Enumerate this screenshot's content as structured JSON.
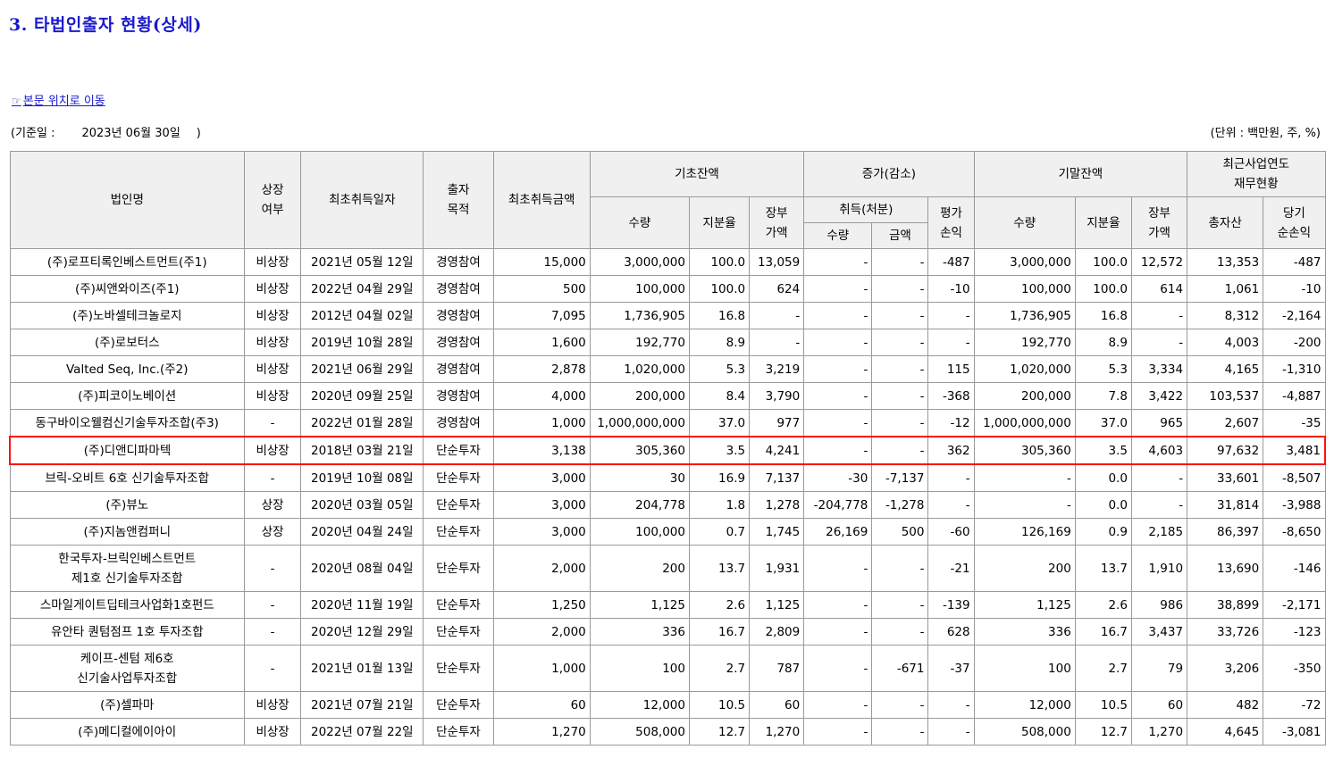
{
  "title": "3. 타법인출자 현황(상세)",
  "nav_link": {
    "icon": "☞",
    "label": "본문 위치로 이동"
  },
  "base_date": {
    "label": "(기준일 :",
    "value": "2023년 06월 30일",
    "close": ")"
  },
  "unit": "(단위 : 백만원, 주, %)",
  "header": {
    "name": "법인명",
    "listed": [
      "상장",
      "여부"
    ],
    "first_date": "최초취득일자",
    "purpose": [
      "출자",
      "목적"
    ],
    "first_amount": "최초취득금액",
    "begin": "기초잔액",
    "change": "증가(감소)",
    "end": "기말잔액",
    "fin": [
      "최근사업연도",
      "재무현황"
    ],
    "qty": "수량",
    "share": "지분율",
    "book": [
      "장부",
      "가액"
    ],
    "acq": "취득(처분)",
    "eval": [
      "평가",
      "손익"
    ],
    "acq_qty": "수량",
    "acq_amt": "금액",
    "total_assets": "총자산",
    "net_income": [
      "당기",
      "순손익"
    ]
  },
  "rows": [
    {
      "name": [
        "(주)로프티록인베스트먼트(주1)"
      ],
      "listed": "비상장",
      "date": "2021년 05월 12일",
      "purpose": "경영참여",
      "amount": "15,000",
      "b_qty": "3,000,000",
      "b_share": "100.0",
      "b_book": "13,059",
      "a_qty": "-",
      "a_amt": "-",
      "eval": "-487",
      "e_qty": "3,000,000",
      "e_share": "100.0",
      "e_book": "12,572",
      "assets": "13,353",
      "income": "-487"
    },
    {
      "name": [
        "(주)씨앤와이즈(주1)"
      ],
      "listed": "비상장",
      "date": "2022년 04월 29일",
      "purpose": "경영참여",
      "amount": "500",
      "b_qty": "100,000",
      "b_share": "100.0",
      "b_book": "624",
      "a_qty": "-",
      "a_amt": "-",
      "eval": "-10",
      "e_qty": "100,000",
      "e_share": "100.0",
      "e_book": "614",
      "assets": "1,061",
      "income": "-10"
    },
    {
      "name": [
        "(주)노바셀테크놀로지"
      ],
      "listed": "비상장",
      "date": "2012년 04월 02일",
      "purpose": "경영참여",
      "amount": "7,095",
      "b_qty": "1,736,905",
      "b_share": "16.8",
      "b_book": "-",
      "a_qty": "-",
      "a_amt": "-",
      "eval": "-",
      "e_qty": "1,736,905",
      "e_share": "16.8",
      "e_book": "-",
      "assets": "8,312",
      "income": "-2,164"
    },
    {
      "name": [
        "(주)로보터스"
      ],
      "listed": "비상장",
      "date": "2019년 10월 28일",
      "purpose": "경영참여",
      "amount": "1,600",
      "b_qty": "192,770",
      "b_share": "8.9",
      "b_book": "-",
      "a_qty": "-",
      "a_amt": "-",
      "eval": "-",
      "e_qty": "192,770",
      "e_share": "8.9",
      "e_book": "-",
      "assets": "4,003",
      "income": "-200"
    },
    {
      "name": [
        "Valted Seq, Inc.(주2)"
      ],
      "listed": "비상장",
      "date": "2021년 06월 29일",
      "purpose": "경영참여",
      "amount": "2,878",
      "b_qty": "1,020,000",
      "b_share": "5.3",
      "b_book": "3,219",
      "a_qty": "-",
      "a_amt": "-",
      "eval": "115",
      "e_qty": "1,020,000",
      "e_share": "5.3",
      "e_book": "3,334",
      "assets": "4,165",
      "income": "-1,310"
    },
    {
      "name": [
        "(주)피코이노베이션"
      ],
      "listed": "비상장",
      "date": "2020년 09월 25일",
      "purpose": "경영참여",
      "amount": "4,000",
      "b_qty": "200,000",
      "b_share": "8.4",
      "b_book": "3,790",
      "a_qty": "-",
      "a_amt": "-",
      "eval": "-368",
      "e_qty": "200,000",
      "e_share": "7.8",
      "e_book": "3,422",
      "assets": "103,537",
      "income": "-4,887"
    },
    {
      "name": [
        "동구바이오웰컴신기술투자조합(주3)"
      ],
      "listed": "-",
      "date": "2022년 01월 28일",
      "purpose": "경영참여",
      "amount": "1,000",
      "b_qty": "1,000,000,000",
      "b_share": "37.0",
      "b_book": "977",
      "a_qty": "-",
      "a_amt": "-",
      "eval": "-12",
      "e_qty": "1,000,000,000",
      "e_share": "37.0",
      "e_book": "965",
      "assets": "2,607",
      "income": "-35"
    },
    {
      "name": [
        "(주)디앤디파마텍"
      ],
      "listed": "비상장",
      "date": "2018년 03월 21일",
      "purpose": "단순투자",
      "amount": "3,138",
      "b_qty": "305,360",
      "b_share": "3.5",
      "b_book": "4,241",
      "a_qty": "-",
      "a_amt": "-",
      "eval": "362",
      "e_qty": "305,360",
      "e_share": "3.5",
      "e_book": "4,603",
      "assets": "97,632",
      "income": "3,481",
      "highlight": true
    },
    {
      "name": [
        "브릭-오비트 6호 신기술투자조합"
      ],
      "listed": "-",
      "date": "2019년 10월 08일",
      "purpose": "단순투자",
      "amount": "3,000",
      "b_qty": "30",
      "b_share": "16.9",
      "b_book": "7,137",
      "a_qty": "-30",
      "a_amt": "-7,137",
      "eval": "-",
      "e_qty": "-",
      "e_share": "0.0",
      "e_book": "-",
      "assets": "33,601",
      "income": "-8,507"
    },
    {
      "name": [
        "(주)뷰노"
      ],
      "listed": "상장",
      "date": "2020년 03월 05일",
      "purpose": "단순투자",
      "amount": "3,000",
      "b_qty": "204,778",
      "b_share": "1.8",
      "b_book": "1,278",
      "a_qty": "-204,778",
      "a_amt": "-1,278",
      "eval": "-",
      "e_qty": "-",
      "e_share": "0.0",
      "e_book": "-",
      "assets": "31,814",
      "income": "-3,988"
    },
    {
      "name": [
        "(주)지놈앤컴퍼니"
      ],
      "listed": "상장",
      "date": "2020년 04월 24일",
      "purpose": "단순투자",
      "amount": "3,000",
      "b_qty": "100,000",
      "b_share": "0.7",
      "b_book": "1,745",
      "a_qty": "26,169",
      "a_amt": "500",
      "eval": "-60",
      "e_qty": "126,169",
      "e_share": "0.9",
      "e_book": "2,185",
      "assets": "86,397",
      "income": "-8,650"
    },
    {
      "name": [
        "한국투자-브릭인베스트먼트",
        "제1호 신기술투자조합"
      ],
      "listed": "-",
      "date": "2020년 08월 04일",
      "purpose": "단순투자",
      "amount": "2,000",
      "b_qty": "200",
      "b_share": "13.7",
      "b_book": "1,931",
      "a_qty": "-",
      "a_amt": "-",
      "eval": "-21",
      "e_qty": "200",
      "e_share": "13.7",
      "e_book": "1,910",
      "assets": "13,690",
      "income": "-146"
    },
    {
      "name": [
        "스마일게이트딥테크사업화1호펀드"
      ],
      "listed": "-",
      "date": "2020년 11월 19일",
      "purpose": "단순투자",
      "amount": "1,250",
      "b_qty": "1,125",
      "b_share": "2.6",
      "b_book": "1,125",
      "a_qty": "-",
      "a_amt": "-",
      "eval": "-139",
      "e_qty": "1,125",
      "e_share": "2.6",
      "e_book": "986",
      "assets": "38,899",
      "income": "-2,171"
    },
    {
      "name": [
        "유안타 퀀텀점프 1호 투자조합"
      ],
      "listed": "-",
      "date": "2020년 12월 29일",
      "purpose": "단순투자",
      "amount": "2,000",
      "b_qty": "336",
      "b_share": "16.7",
      "b_book": "2,809",
      "a_qty": "-",
      "a_amt": "-",
      "eval": "628",
      "e_qty": "336",
      "e_share": "16.7",
      "e_book": "3,437",
      "assets": "33,726",
      "income": "-123"
    },
    {
      "name": [
        "케이프-센텀 제6호",
        "신기술사업투자조합"
      ],
      "listed": "-",
      "date": "2021년 01월 13일",
      "purpose": "단순투자",
      "amount": "1,000",
      "b_qty": "100",
      "b_share": "2.7",
      "b_book": "787",
      "a_qty": "-",
      "a_amt": "-671",
      "eval": "-37",
      "e_qty": "100",
      "e_share": "2.7",
      "e_book": "79",
      "assets": "3,206",
      "income": "-350"
    },
    {
      "name": [
        "(주)셀파마"
      ],
      "listed": "비상장",
      "date": "2021년 07월 21일",
      "purpose": "단순투자",
      "amount": "60",
      "b_qty": "12,000",
      "b_share": "10.5",
      "b_book": "60",
      "a_qty": "-",
      "a_amt": "-",
      "eval": "-",
      "e_qty": "12,000",
      "e_share": "10.5",
      "e_book": "60",
      "assets": "482",
      "income": "-72"
    },
    {
      "name": [
        "(주)메디컬에이아이"
      ],
      "listed": "비상장",
      "date": "2022년 07월 22일",
      "purpose": "단순투자",
      "amount": "1,270",
      "b_qty": "508,000",
      "b_share": "12.7",
      "b_book": "1,270",
      "a_qty": "-",
      "a_amt": "-",
      "eval": "-",
      "e_qty": "508,000",
      "e_share": "12.7",
      "e_book": "1,270",
      "assets": "4,645",
      "income": "-3,081"
    }
  ]
}
